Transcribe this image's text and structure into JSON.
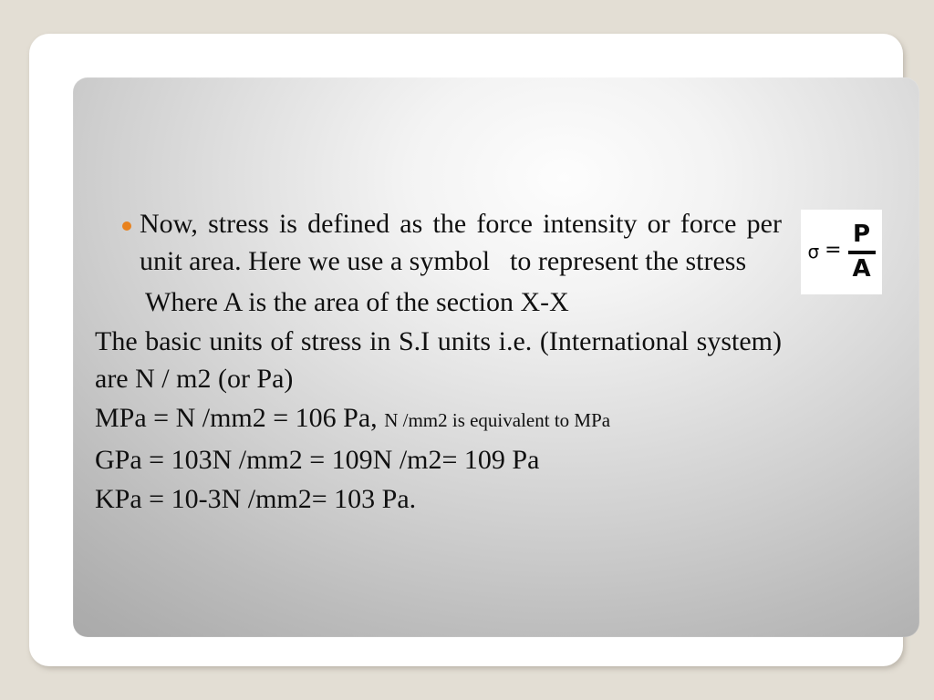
{
  "slide": {
    "background_color": "#e3ded4",
    "frame_color": "#ffffff",
    "panel_gradient_light": "#fdfdfd",
    "panel_gradient_dark": "#9e9e9e",
    "bullet_color": "#e8821e"
  },
  "content": {
    "bullet_paragraph": {
      "marker": "bullet-dot",
      "text_part_1": "Now, stress is defined as the force intensity or force per unit area. Here we use a symbol",
      "text_part_2": "to represent the stress"
    },
    "where_line": "Where A is the area of the section X-X",
    "si_units_paragraph": "The basic units of stress in S.I units i.e. (International system) are N / m2 (or Pa)",
    "mpa_line": {
      "main": "MPa = N /mm2 = 106 Pa,",
      "note": "N /mm2 is equivalent to MPa"
    },
    "gpa_line": "GPa = 103N /mm2 = 109N /m2= 109 Pa",
    "kpa_line": "KPa = 10-3N /mm2= 103 Pa."
  },
  "formula_image": {
    "symbol": "σ",
    "equals": "=",
    "numerator": "P",
    "denominator": "A",
    "alt": "sigma equals P over A"
  }
}
